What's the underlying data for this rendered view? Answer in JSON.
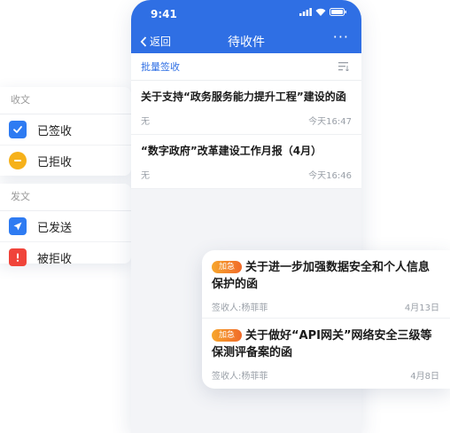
{
  "side_panel": {
    "received_section": "收文",
    "received_items": [
      {
        "label": "已签收",
        "icon": "check-icon",
        "color": "#2e7bf2"
      },
      {
        "label": "已拒收",
        "icon": "minus-icon",
        "color": "#f6b11a"
      }
    ],
    "sent_section": "发文",
    "sent_items": [
      {
        "label": "已发送",
        "icon": "send-icon",
        "color": "#2e7bf2"
      },
      {
        "label": "被拒收",
        "icon": "alert-icon",
        "color": "#f0443a"
      }
    ]
  },
  "phone": {
    "status_time": "9:41",
    "nav": {
      "back_label": "返回",
      "title": "待收件",
      "more": "···"
    },
    "toolbar": {
      "batch_label": "批量签收"
    },
    "documents": [
      {
        "title": "关于支持“政务服务能力提升工程”建设的函",
        "sender": "无",
        "time": "今天16:47"
      },
      {
        "title": "“数字政府”改革建设工作月报（4月）",
        "sender": "无",
        "time": "今天16:46"
      }
    ]
  },
  "urgent_card": {
    "items": [
      {
        "badge": "加急",
        "title": "关于进一步加强数据安全和个人信息保护的函",
        "signer": "签收人:杨菲菲",
        "date": "4月13日"
      },
      {
        "badge": "加急",
        "title": "关于做好“API网关”网络安全三级等保测评备案的函",
        "signer": "签收人:杨菲菲",
        "date": "4月8日"
      }
    ]
  },
  "colors": {
    "brand_blue": "#2f6fe4",
    "urgent_orange": "#f07a2a"
  }
}
